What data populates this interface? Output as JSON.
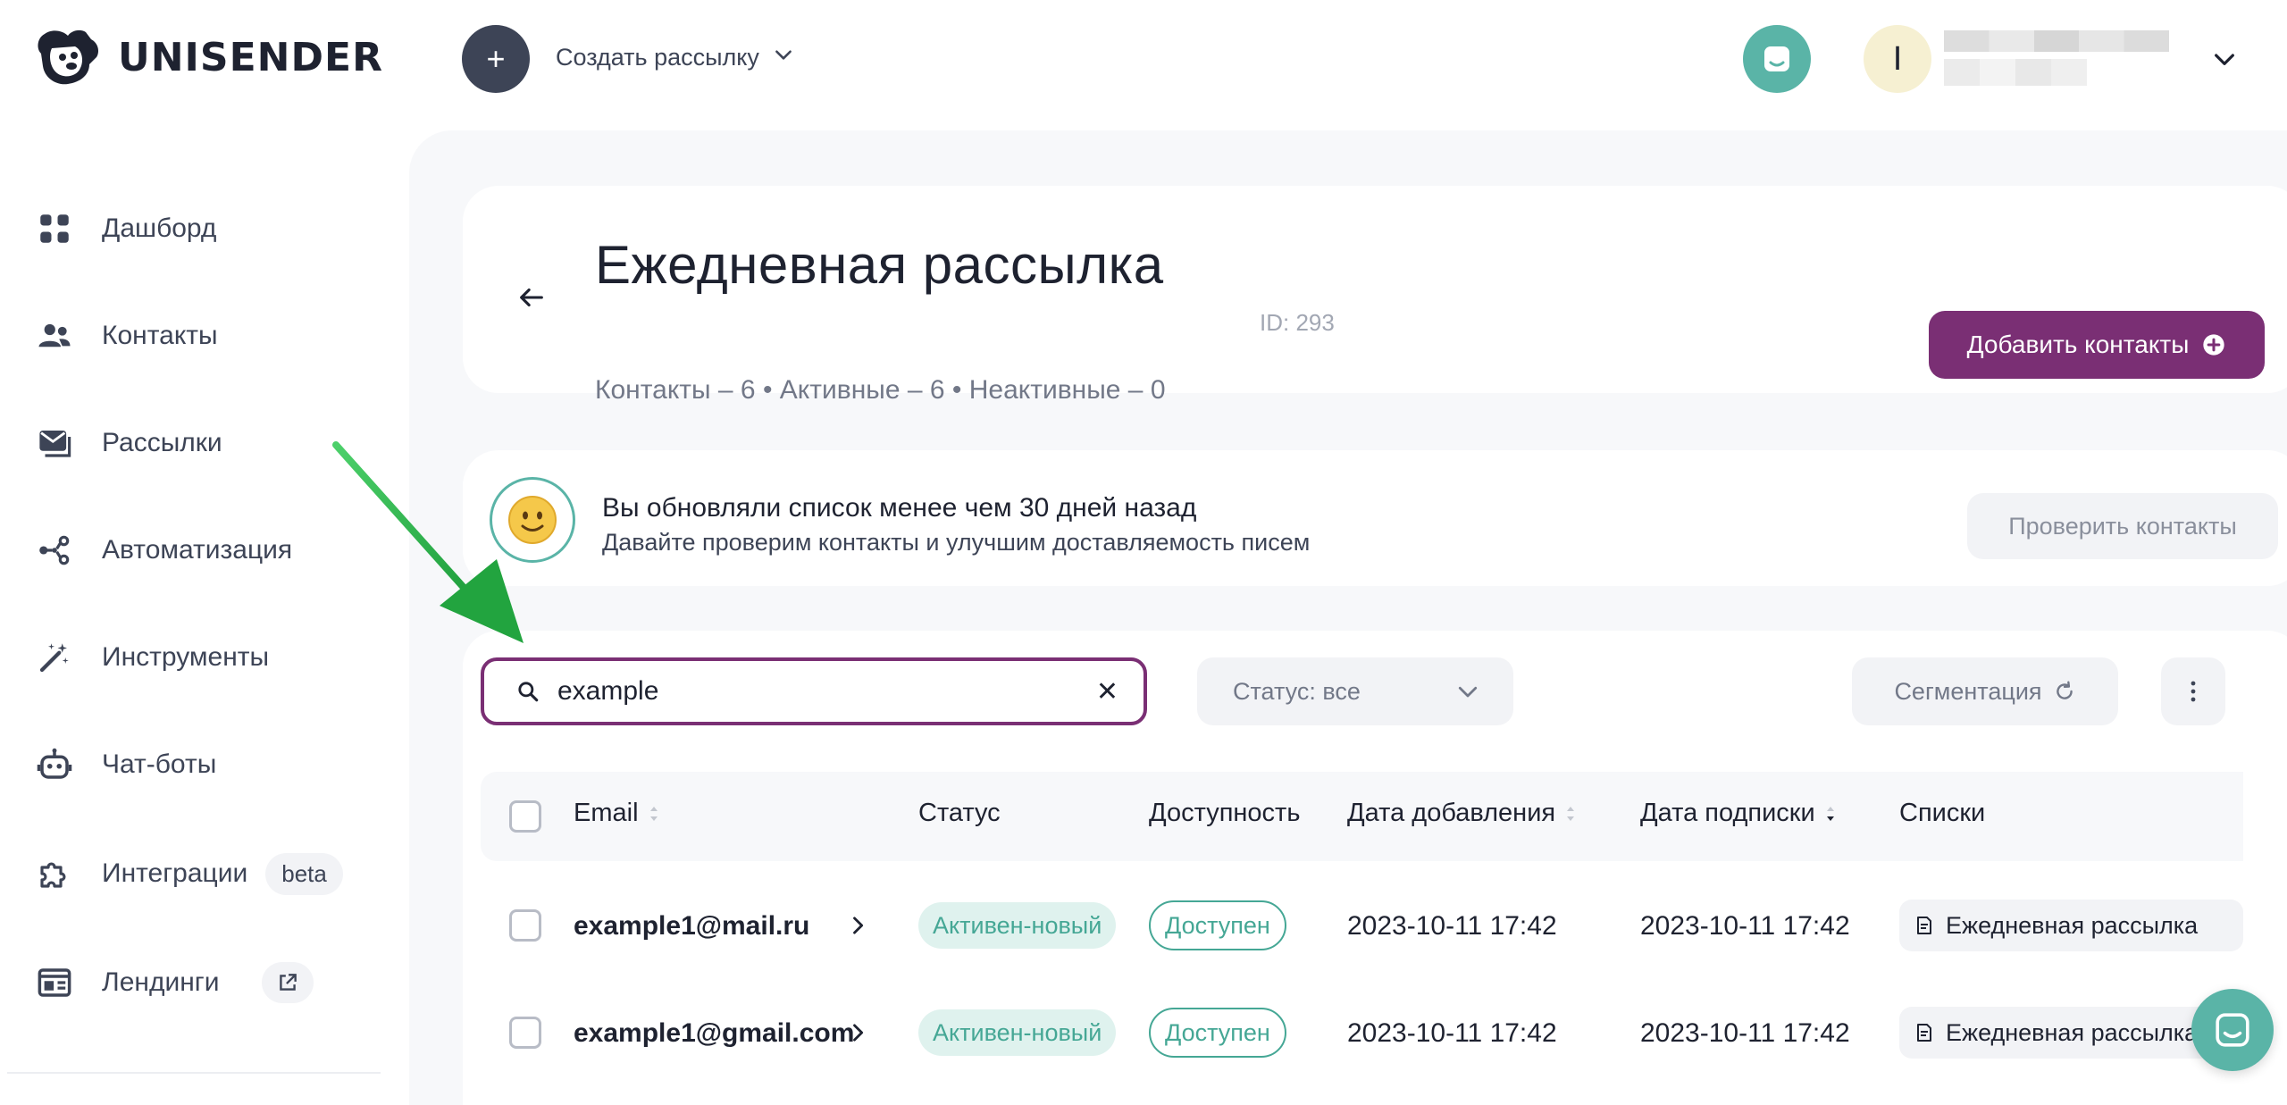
{
  "brand": {
    "name": "UNISENDER"
  },
  "topbar": {
    "create_label": "Создать рассылку",
    "avatar_initial": "I"
  },
  "sidebar": {
    "items": [
      {
        "label": "Дашборд",
        "icon": "dashboard-grid-icon"
      },
      {
        "label": "Контакты",
        "icon": "contacts-people-icon"
      },
      {
        "label": "Рассылки",
        "icon": "mail-icon"
      },
      {
        "label": "Автоматизация",
        "icon": "automation-nodes-icon"
      },
      {
        "label": "Инструменты",
        "icon": "magic-wand-icon"
      },
      {
        "label": "Чат-боты",
        "icon": "robot-icon"
      },
      {
        "label": "Интеграции",
        "icon": "puzzle-icon",
        "badge": "beta"
      },
      {
        "label": "Лендинги",
        "icon": "landing-page-icon",
        "external_icon": "external-link-icon"
      }
    ]
  },
  "header": {
    "title": "Ежедневная рассылка",
    "id_label": "ID: 293",
    "stats": "Контакты – 6 • Активные – 6 • Неактивные – 0",
    "add_contacts_label": "Добавить контакты"
  },
  "notice": {
    "title": "Вы обновляли список менее чем 30 дней назад",
    "subtitle": "Давайте проверим контакты и улучшим доставляемость писем",
    "check_label": "Проверить контакты"
  },
  "filters": {
    "search_value": "example",
    "status_label": "Статус: все",
    "segmentation_label": "Сегментация"
  },
  "table": {
    "columns": [
      "Email",
      "Статус",
      "Доступность",
      "Дата добавления",
      "Дата подписки",
      "Списки"
    ],
    "rows": [
      {
        "email": "example1@mail.ru",
        "status": "Активен-новый",
        "availability": "Доступен",
        "added": "2023-10-11 17:42",
        "subscribed": "2023-10-11 17:42",
        "list": "Ежедневная рассылка"
      },
      {
        "email": "example1@gmail.com",
        "status": "Активен-новый",
        "availability": "Доступен",
        "added": "2023-10-11 17:42",
        "subscribed": "2023-10-11 17:42",
        "list": "Ежедневная рассылка"
      }
    ]
  },
  "colors": {
    "accent": "#7a2f74",
    "teal": "#5ab4a7",
    "status_green": "#45a795",
    "annotation_arrow": "#2fb24a"
  }
}
